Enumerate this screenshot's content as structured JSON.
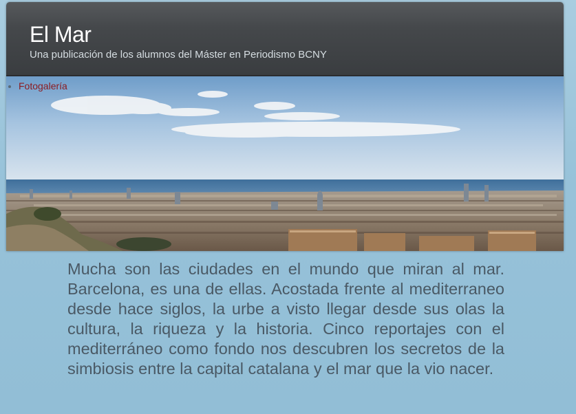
{
  "site": {
    "title": "El Mar",
    "tagline": "Una publicación de los alumnos del Máster en Periodismo BCNY"
  },
  "nav": {
    "items": [
      {
        "label": "Fotogalería"
      }
    ]
  },
  "banner": {
    "subject": "barcelona-skyline-over-mediterranean"
  },
  "main": {
    "intro": "Mucha son las ciudades en el mundo que miran al mar. Barcelona, es una de ellas. Acostada frente al mediterraneo desde hace siglos, la urbe a visto llegar desde sus olas la cultura, la riqueza y la historia. Cinco reportajes con el mediterráneo como fondo nos descubren los secretos de la simbiosis entre la capital catalana y el mar que la vio nacer."
  },
  "colors": {
    "background": "#97c1d8",
    "header": "#45484b",
    "link": "#8b1a1f",
    "body_text": "#4a5965"
  }
}
